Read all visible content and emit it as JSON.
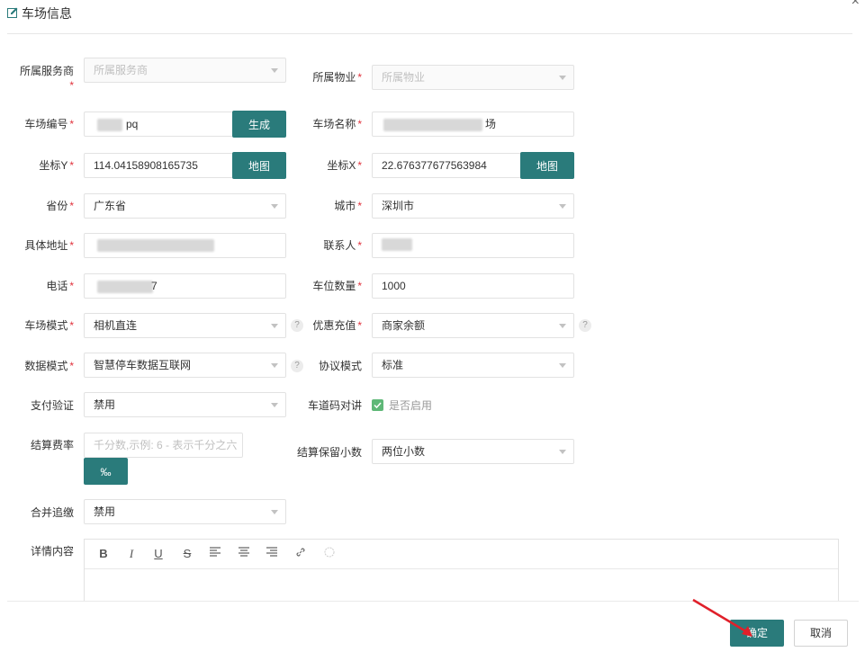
{
  "dialog": {
    "title": "车场信息",
    "close_glyph": "×"
  },
  "form": {
    "service_provider": {
      "label": "所属服务商",
      "placeholder": "所属服务商"
    },
    "property": {
      "label": "所属物业",
      "placeholder": "所属物业"
    },
    "lot_code": {
      "label": "车场编号",
      "value": "pq",
      "button": "生成"
    },
    "lot_name": {
      "label": "车场名称",
      "value": "场"
    },
    "coord_y": {
      "label": "坐标Y",
      "value": "114.04158908165735",
      "button": "地图"
    },
    "coord_x": {
      "label": "坐标X",
      "value": "22.676377677563984",
      "button": "地图"
    },
    "province": {
      "label": "省份",
      "value": "广东省"
    },
    "city": {
      "label": "城市",
      "value": "深圳市"
    },
    "address": {
      "label": "具体地址"
    },
    "contact": {
      "label": "联系人"
    },
    "phone": {
      "label": "电话",
      "value": "7"
    },
    "spaces": {
      "label": "车位数量",
      "value": "1000"
    },
    "lot_mode": {
      "label": "车场模式",
      "value": "相机直连"
    },
    "discount_recharge": {
      "label": "优惠充值",
      "value": "商家余额"
    },
    "data_mode": {
      "label": "数据模式",
      "value": "智慧停车数据互联网"
    },
    "protocol_mode": {
      "label": "协议模式",
      "value": "标准"
    },
    "payment_verify": {
      "label": "支付验证",
      "value": "禁用"
    },
    "lane_intercom": {
      "label": "车道码对讲",
      "checkbox_label": "是否启用"
    },
    "settle_rate": {
      "label": "结算费率",
      "placeholder": "千分数,示例: 6 - 表示千分之六",
      "unit_button": "‰"
    },
    "settle_decimals": {
      "label": "结算保留小数",
      "value": "两位小数"
    },
    "merge_tracking": {
      "label": "合并追缴",
      "value": "禁用"
    },
    "details": {
      "label": "详情内容"
    }
  },
  "editor_tools": [
    "B",
    "I",
    "U",
    "S",
    "align-left",
    "align-center",
    "align-right",
    "link",
    "emoji"
  ],
  "footer": {
    "ok": "确定",
    "cancel": "取消"
  },
  "colors": {
    "primary": "#2a7b7b",
    "required": "#e0323c",
    "checkbox": "#5fb878"
  },
  "help_glyph": "?"
}
